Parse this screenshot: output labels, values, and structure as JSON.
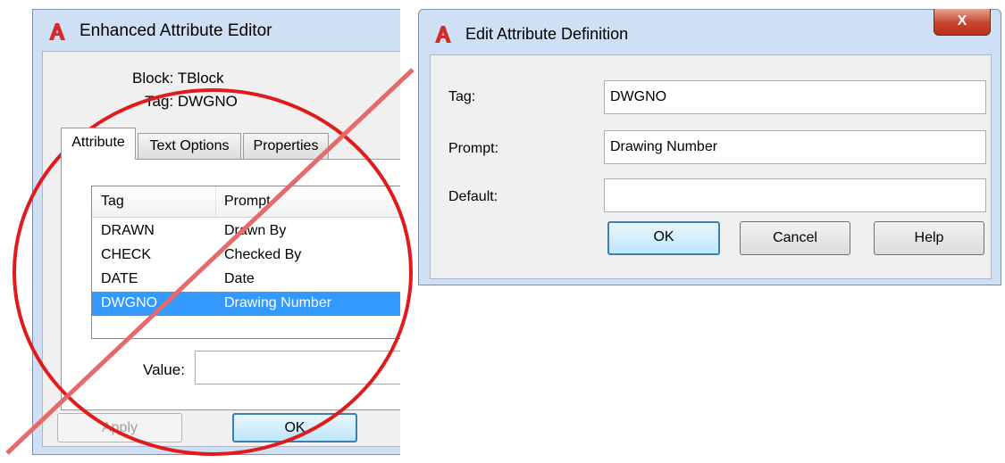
{
  "left_window": {
    "title": "Enhanced Attribute Editor",
    "block": "Block: TBlock",
    "tag": "Tag: DWGNO",
    "tabs": [
      "Attribute",
      "Text Options",
      "Properties"
    ],
    "list": {
      "columns": [
        "Tag",
        "Prompt"
      ],
      "rows": [
        {
          "tag": "DRAWN",
          "prompt": "Drawn By"
        },
        {
          "tag": "CHECK",
          "prompt": "Checked By"
        },
        {
          "tag": "DATE",
          "prompt": "Date"
        },
        {
          "tag": "DWGNO",
          "prompt": "Drawing Number",
          "selected": true
        }
      ]
    },
    "value_label": "Value:",
    "value": "",
    "apply_label": "Apply",
    "ok_label": "OK"
  },
  "right_window": {
    "title": "Edit Attribute Definition",
    "close_label": "X",
    "tag_label": "Tag:",
    "tag_value": "DWGNO",
    "prompt_label": "Prompt:",
    "prompt_value": "Drawing Number",
    "default_label": "Default:",
    "default_value": "",
    "ok_label": "OK",
    "cancel_label": "Cancel",
    "help_label": "Help"
  },
  "icons": {
    "app_logo": "autocad-logo-icon",
    "overlay": "prohibition-icon"
  },
  "colors": {
    "logo_red": "#d62b2b",
    "selection_blue": "#3399ff",
    "overlay_red": "#e01b1b",
    "title_bar": "#cfe0f4"
  }
}
